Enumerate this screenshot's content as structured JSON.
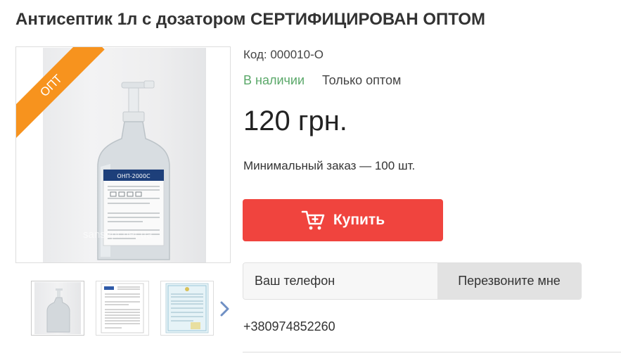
{
  "product": {
    "title": "Антисептик 1л с дозатором СЕРТИФИЦИРОВАН ОПТОМ",
    "code": "Код: 000010-О",
    "stock_status": "В наличии",
    "wholesale_label": "Только оптом",
    "price": "120 грн.",
    "min_order": "Минимальный заказ — 100 шт.",
    "badge": "ОПТ",
    "watermark": "sansept.net.ua",
    "bottle_label": "ОНП-2000С"
  },
  "buy_button": {
    "label": "Купить",
    "icon": "cart-icon"
  },
  "callback": {
    "phone_placeholder": "Ваш телефон",
    "button_label": "Перезвоните мне"
  },
  "contact": {
    "phone": "+380974852260"
  },
  "thumbnails": [
    {
      "name": "thumbnail-bottle"
    },
    {
      "name": "thumbnail-certificate"
    },
    {
      "name": "thumbnail-document"
    }
  ],
  "colors": {
    "buy_button": "#f0443e",
    "in_stock": "#5aa869",
    "badge": "#f7931e"
  }
}
